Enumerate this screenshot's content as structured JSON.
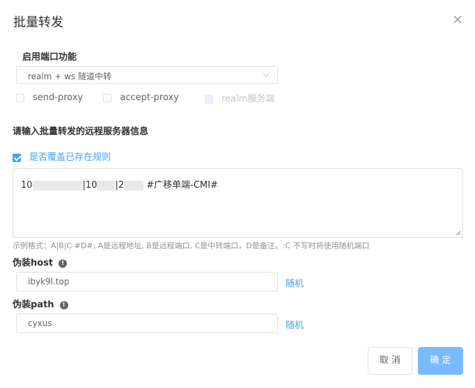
{
  "dialog": {
    "title": "批量转发",
    "close_icon": "close-icon"
  },
  "port_function": {
    "label": "启用端口功能",
    "selected": "realm + ws 隧道中转",
    "options": {
      "send_proxy": "send-proxy",
      "accept_proxy": "accept-proxy",
      "realm_server": "realm服务端"
    }
  },
  "remote_info": {
    "label": "请输入批量转发的远程服务器信息",
    "overwrite_label": "是否覆盖已存在规则",
    "overwrite_checked": true,
    "textarea": {
      "part1": "10",
      "part2": "|10",
      "part3": "|2",
      "part4": "#广移单端-CMI#"
    },
    "hint": "示例格式：A|B|C #D#, A是远程地址, B是远程端口, C是中转端口，D是备注。:C 不写时将使用随机端口"
  },
  "fake_host": {
    "label": "伪装host",
    "value": "ibyk9l.top",
    "random": "随机"
  },
  "fake_path": {
    "label": "伪装path",
    "value": "cyxus",
    "random": "随机"
  },
  "footer": {
    "cancel": "取 消",
    "confirm": "确 定"
  },
  "colors": {
    "primary": "#409eff",
    "primary_disabled": "#79bbff"
  }
}
